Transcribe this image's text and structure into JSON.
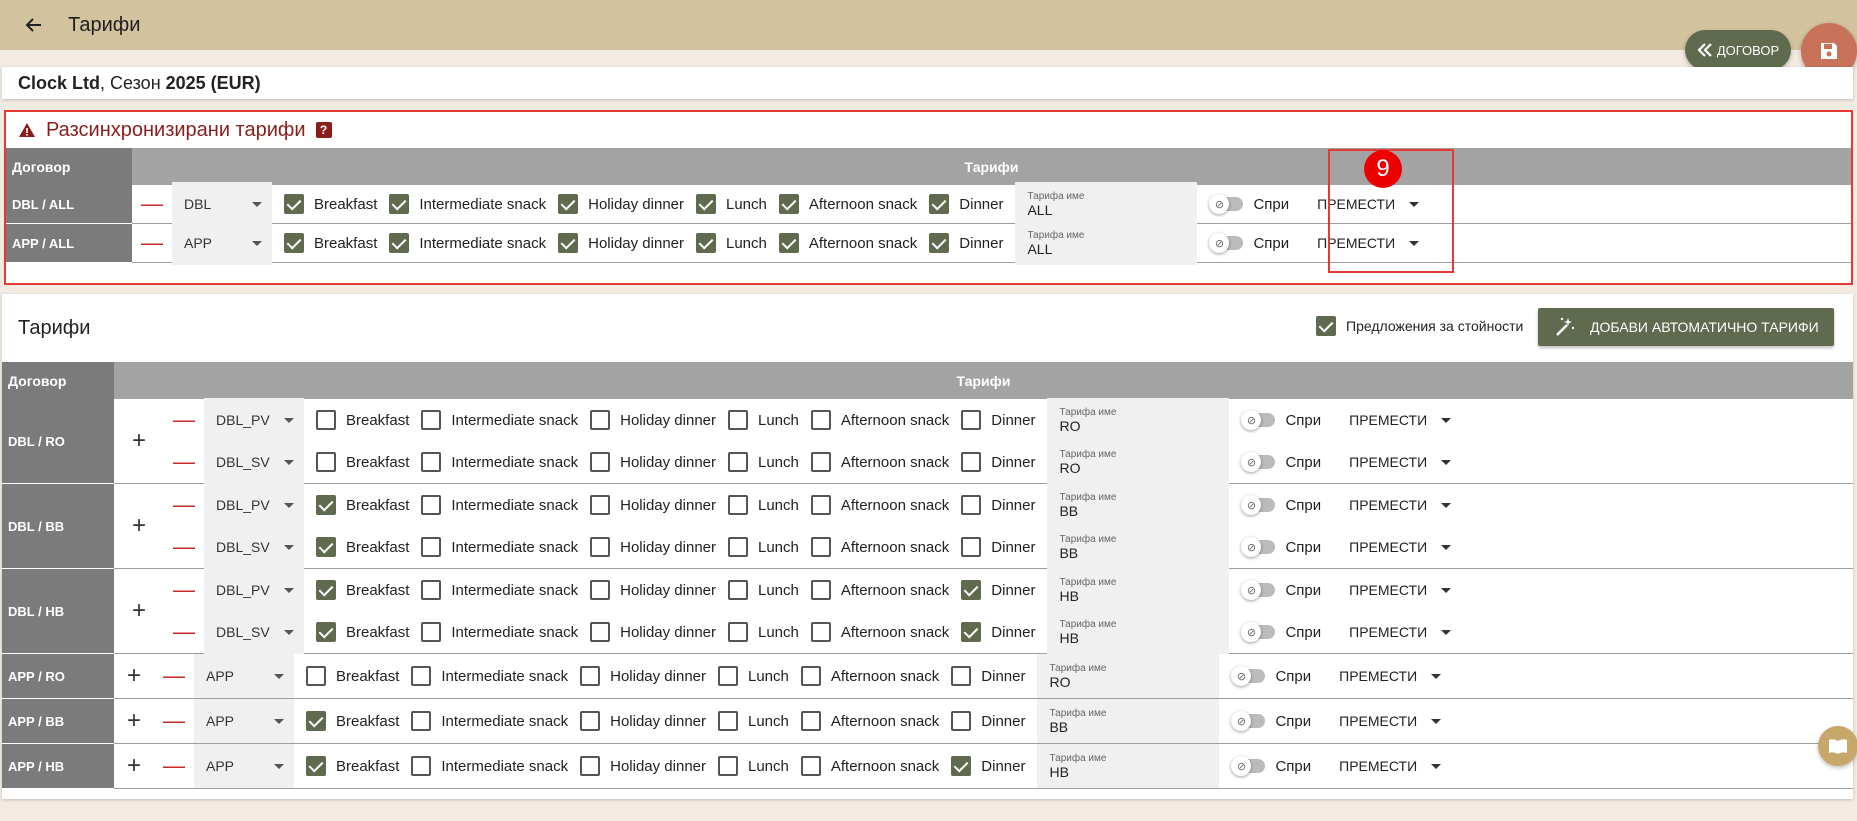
{
  "header": {
    "title": "Тарифи"
  },
  "buttons": {
    "dogovor": "ДОГОВОР"
  },
  "contract": {
    "company": "Clock Ltd",
    "rest": ", Сезон ",
    "season": "2025 (EUR)"
  },
  "unsync": {
    "title": "Разсинхронизирани тарифи",
    "help": "?",
    "col_contract": "Договор",
    "col_rates": "Тарифи",
    "badge": "9",
    "rows": [
      {
        "label": "DBL / ALL",
        "room": "DBL",
        "meals": [
          true,
          true,
          true,
          true,
          true,
          true
        ],
        "rate_label": "Тарифа име",
        "rate_name": "ALL",
        "stop": "Спри",
        "move": "ПРЕМЕСТИ"
      },
      {
        "label": "APP / ALL",
        "room": "APP",
        "meals": [
          true,
          true,
          true,
          true,
          true,
          true
        ],
        "rate_label": "Тарифа име",
        "rate_name": "ALL",
        "stop": "Спри",
        "move": "ПРЕМЕСТИ"
      }
    ]
  },
  "meal_names": [
    "Breakfast",
    "Intermediate snack",
    "Holiday dinner",
    "Lunch",
    "Afternoon snack",
    "Dinner"
  ],
  "tarifi": {
    "title": "Тарифи",
    "offers_label": "Предложения за стойности",
    "auto_button": "ДОБАВИ АВТОМАТИЧНО ТАРИФИ",
    "col_contract": "Договор",
    "col_rates": "Тарифи",
    "groups": [
      {
        "label": "DBL / RO",
        "lines": [
          {
            "room": "DBL_PV",
            "meals": [
              false,
              false,
              false,
              false,
              false,
              false
            ],
            "rate_label": "Тарифа име",
            "rate_name": "RO",
            "stop": "Спри",
            "move": "ПРЕМЕСТИ"
          },
          {
            "room": "DBL_SV",
            "meals": [
              false,
              false,
              false,
              false,
              false,
              false
            ],
            "rate_label": "Тарифа име",
            "rate_name": "RO",
            "stop": "Спри",
            "move": "ПРЕМЕСТИ"
          }
        ]
      },
      {
        "label": "DBL / BB",
        "lines": [
          {
            "room": "DBL_PV",
            "meals": [
              true,
              false,
              false,
              false,
              false,
              false
            ],
            "rate_label": "Тарифа име",
            "rate_name": "BB",
            "stop": "Спри",
            "move": "ПРЕМЕСТИ"
          },
          {
            "room": "DBL_SV",
            "meals": [
              true,
              false,
              false,
              false,
              false,
              false
            ],
            "rate_label": "Тарифа име",
            "rate_name": "BB",
            "stop": "Спри",
            "move": "ПРЕМЕСТИ"
          }
        ]
      },
      {
        "label": "DBL / HB",
        "lines": [
          {
            "room": "DBL_PV",
            "meals": [
              true,
              false,
              false,
              false,
              false,
              true
            ],
            "rate_label": "Тарифа име",
            "rate_name": "HB",
            "stop": "Спри",
            "move": "ПРЕМЕСТИ"
          },
          {
            "room": "DBL_SV",
            "meals": [
              true,
              false,
              false,
              false,
              false,
              true
            ],
            "rate_label": "Тарифа име",
            "rate_name": "HB",
            "stop": "Спри",
            "move": "ПРЕМЕСТИ"
          }
        ]
      },
      {
        "label": "APP / RO",
        "lines": [
          {
            "room": "APP",
            "meals": [
              false,
              false,
              false,
              false,
              false,
              false
            ],
            "rate_label": "Тарифа име",
            "rate_name": "RO",
            "stop": "Спри",
            "move": "ПРЕМЕСТИ"
          }
        ]
      },
      {
        "label": "APP / BB",
        "lines": [
          {
            "room": "APP",
            "meals": [
              true,
              false,
              false,
              false,
              false,
              false
            ],
            "rate_label": "Тарифа име",
            "rate_name": "BB",
            "stop": "Спри",
            "move": "ПРЕМЕСТИ"
          }
        ]
      },
      {
        "label": "APP / HB",
        "lines": [
          {
            "room": "APP",
            "meals": [
              true,
              false,
              false,
              false,
              false,
              true
            ],
            "rate_label": "Тарифа име",
            "rate_name": "HB",
            "stop": "Спри",
            "move": "ПРЕМЕСТИ"
          }
        ]
      }
    ]
  }
}
